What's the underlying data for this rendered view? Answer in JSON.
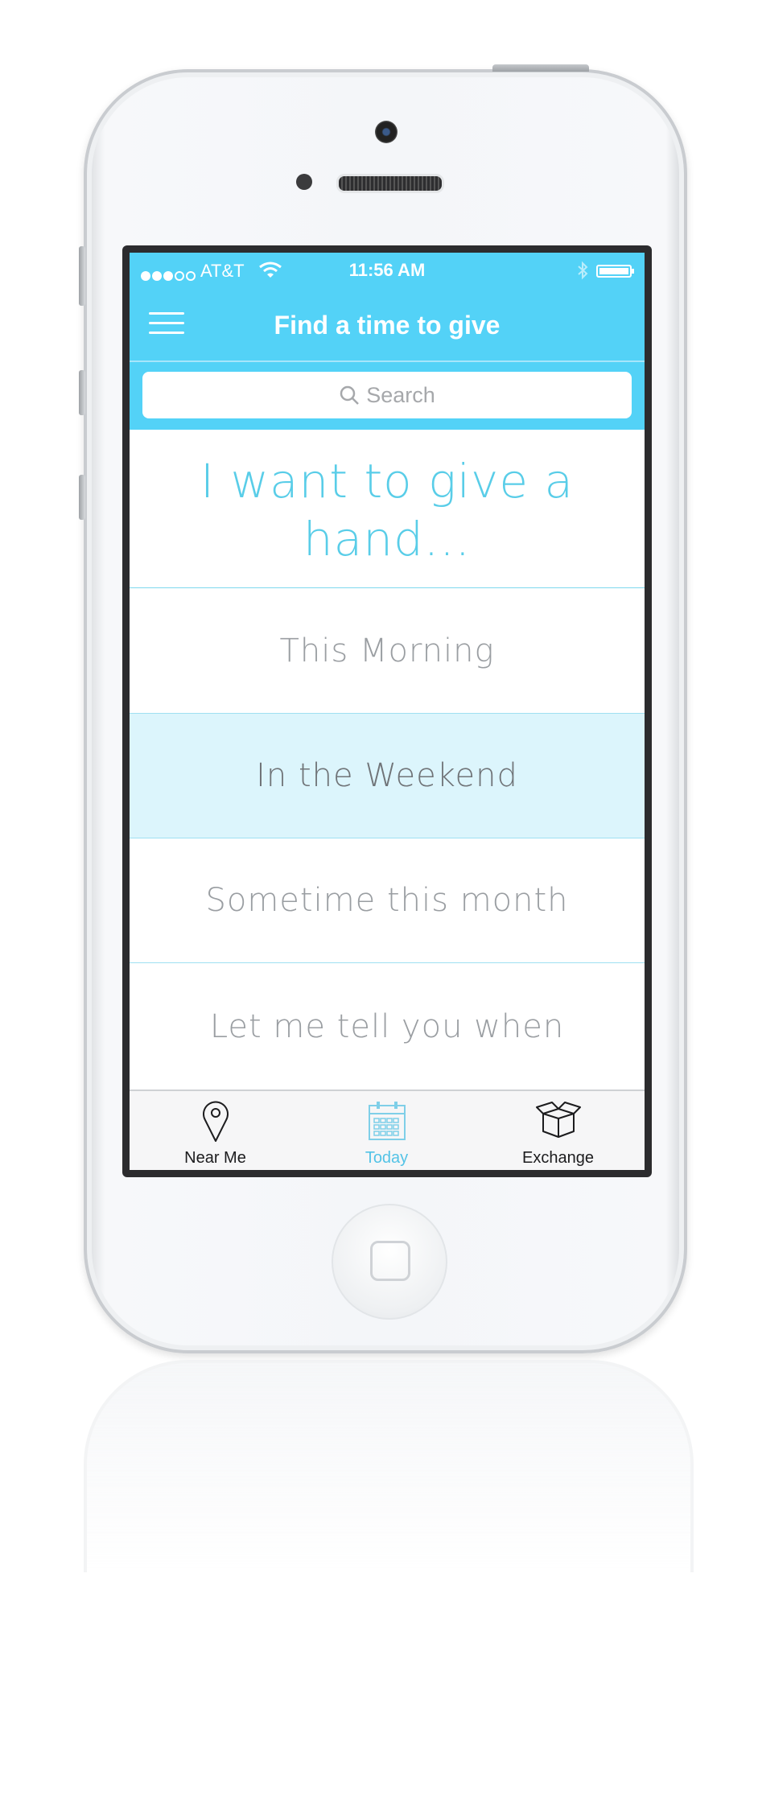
{
  "status_bar": {
    "carrier": "AT&T",
    "time": "11:56 AM"
  },
  "nav": {
    "title": "Find a time to give"
  },
  "search": {
    "placeholder": "Search"
  },
  "heading": {
    "line1": "I want to give a",
    "line2": "hand..."
  },
  "options": [
    {
      "label": "This Morning",
      "selected": false
    },
    {
      "label": "In the Weekend",
      "selected": true
    },
    {
      "label": "Sometime this month",
      "selected": false
    },
    {
      "label": "Let me tell you when",
      "selected": false
    }
  ],
  "tabs": [
    {
      "label": "Near Me",
      "icon": "location-pin-icon",
      "active": false
    },
    {
      "label": "Today",
      "icon": "calendar-icon",
      "active": true
    },
    {
      "label": "Exchange",
      "icon": "box-icon",
      "active": false
    }
  ],
  "colors": {
    "accent": "#53d2f7",
    "heading": "#59cde8",
    "selected_row": "#dcf5fc",
    "active_tab": "#53c3e6"
  }
}
